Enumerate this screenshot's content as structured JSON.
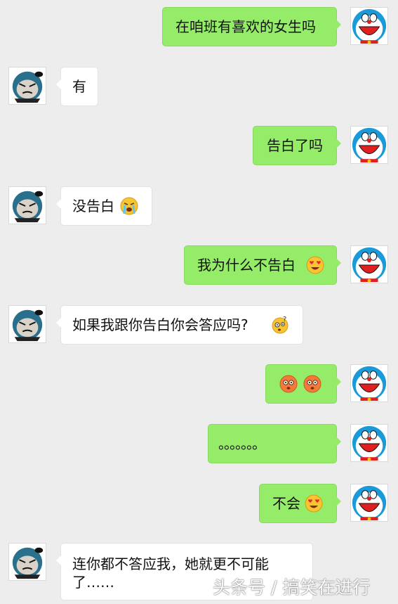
{
  "chat": {
    "messages": [
      {
        "side": "right",
        "text": "在咱班有喜欢的女生吗",
        "emojis": []
      },
      {
        "side": "left",
        "text": "有",
        "emojis": []
      },
      {
        "side": "right",
        "text": "告白了吗",
        "emojis": []
      },
      {
        "side": "left",
        "text": "没告白",
        "emojis": [
          "crying-face-icon"
        ]
      },
      {
        "side": "right",
        "text": "我为什么不告白",
        "emojis": [
          "heart-eyes-icon"
        ]
      },
      {
        "side": "left",
        "text": "如果我跟你告白你会答应吗?",
        "emojis": [
          "confused-face-icon"
        ]
      },
      {
        "side": "right",
        "text": "",
        "emojis": [
          "flushed-face-icon",
          "flushed-face-icon"
        ]
      },
      {
        "side": "right",
        "text": "。。。。。。。",
        "emojis": []
      },
      {
        "side": "right",
        "text": "不会",
        "emojis": [
          "heart-eyes-icon"
        ]
      },
      {
        "side": "left",
        "text": "连你都不答应我，她就更不可能了……",
        "emojis": []
      }
    ]
  },
  "avatars": {
    "self": "doraemon-avatar-icon",
    "other": "cartoon-monster-avatar-icon"
  },
  "watermark": "头条号 / 搞笑在进行",
  "colors": {
    "background": "#ededed",
    "right_bubble": "#95ec69",
    "left_bubble": "#ffffff"
  }
}
